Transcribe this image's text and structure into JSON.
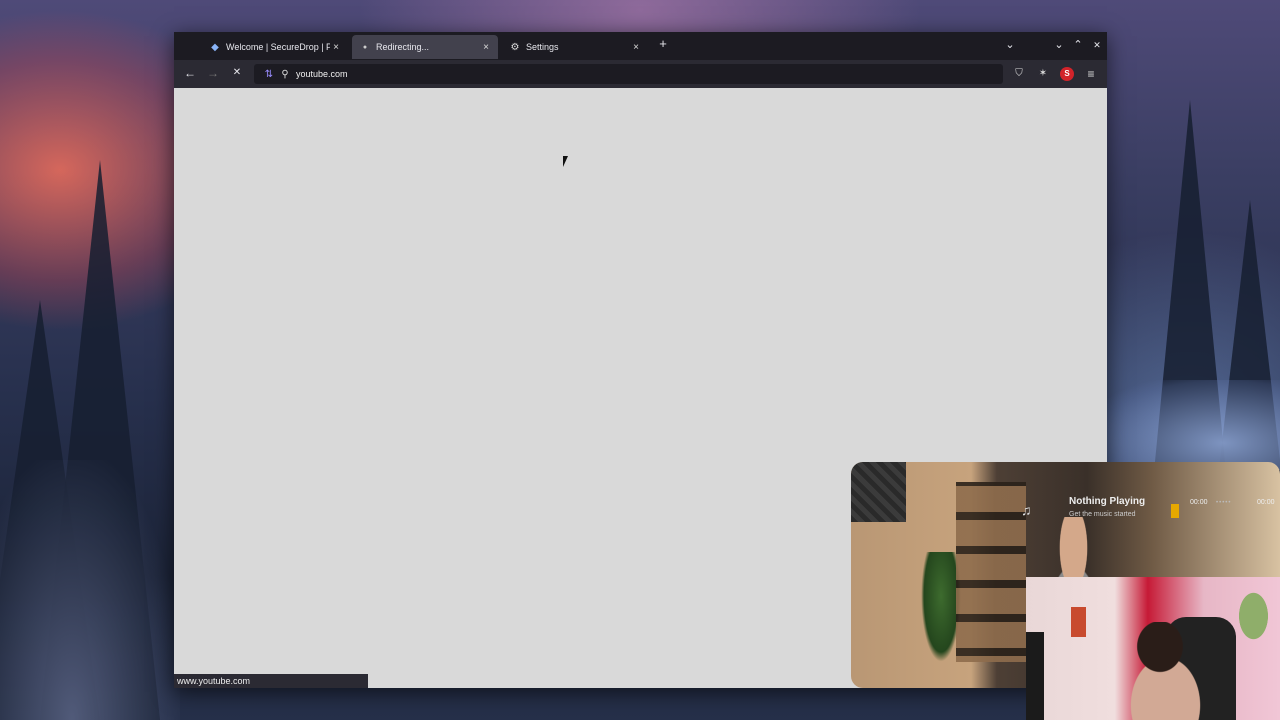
{
  "browser": {
    "tabs": [
      {
        "title": "Welcome | SecureDrop | Pr",
        "icon": "securedrop-icon",
        "active": false
      },
      {
        "title": "Redirecting...",
        "icon": "loading-dot-icon",
        "active": true
      },
      {
        "title": "Settings",
        "icon": "gear-icon",
        "active": false
      }
    ],
    "new_tab_label": "+",
    "url": "youtube.com",
    "status_url": "www.youtube.com"
  },
  "now_playing": {
    "title": "Nothing Playing",
    "subtitle": "Get the music started",
    "time_elapsed": "00:00",
    "time_total": "00:00"
  },
  "icons": {
    "back": "←",
    "forward": "→",
    "stop": "✕",
    "close": "×",
    "list_all_tabs": "⌄",
    "minimize": "⌄",
    "maximize": "⌃",
    "close_window": "✕",
    "shield": "⛉",
    "extensions": "✶",
    "menu": "≡",
    "search": "⚲",
    "music_note": "♫"
  },
  "colors": {
    "content_bg": "#d9d9d9",
    "tab_active": "#42414d",
    "toolbar": "#2b2a33",
    "accent_progress": "#e6a800"
  }
}
